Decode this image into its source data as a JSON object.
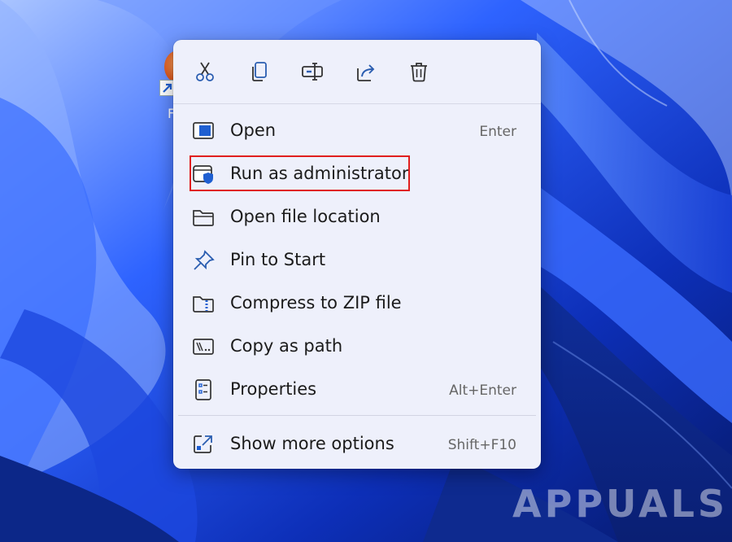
{
  "toolbar": {
    "cut": "cut-icon",
    "copy": "copy-icon",
    "rename": "rename-icon",
    "share": "share-icon",
    "delete": "delete-icon"
  },
  "menu": {
    "items": [
      {
        "label": "Open",
        "shortcut": "Enter",
        "icon": "open-app-icon"
      },
      {
        "label": "Run as administrator",
        "shortcut": "",
        "icon": "shield-icon"
      },
      {
        "label": "Open file location",
        "shortcut": "",
        "icon": "folder-icon"
      },
      {
        "label": "Pin to Start",
        "shortcut": "",
        "icon": "pin-icon"
      },
      {
        "label": "Compress to ZIP file",
        "shortcut": "",
        "icon": "zip-folder-icon"
      },
      {
        "label": "Copy as path",
        "shortcut": "",
        "icon": "copy-path-icon"
      },
      {
        "label": "Properties",
        "shortcut": "Alt+Enter",
        "icon": "properties-icon"
      },
      {
        "label": "Show more options",
        "shortcut": "Shift+F10",
        "icon": "more-options-icon"
      }
    ]
  },
  "colors": {
    "menu_bg": "#eef0fb",
    "highlight": "#e01e1e",
    "accent": "#1f5fd1",
    "desktop": "#0b2a9a"
  },
  "desktop": {
    "shortcut_label": "F"
  },
  "watermark": "APPUALS"
}
